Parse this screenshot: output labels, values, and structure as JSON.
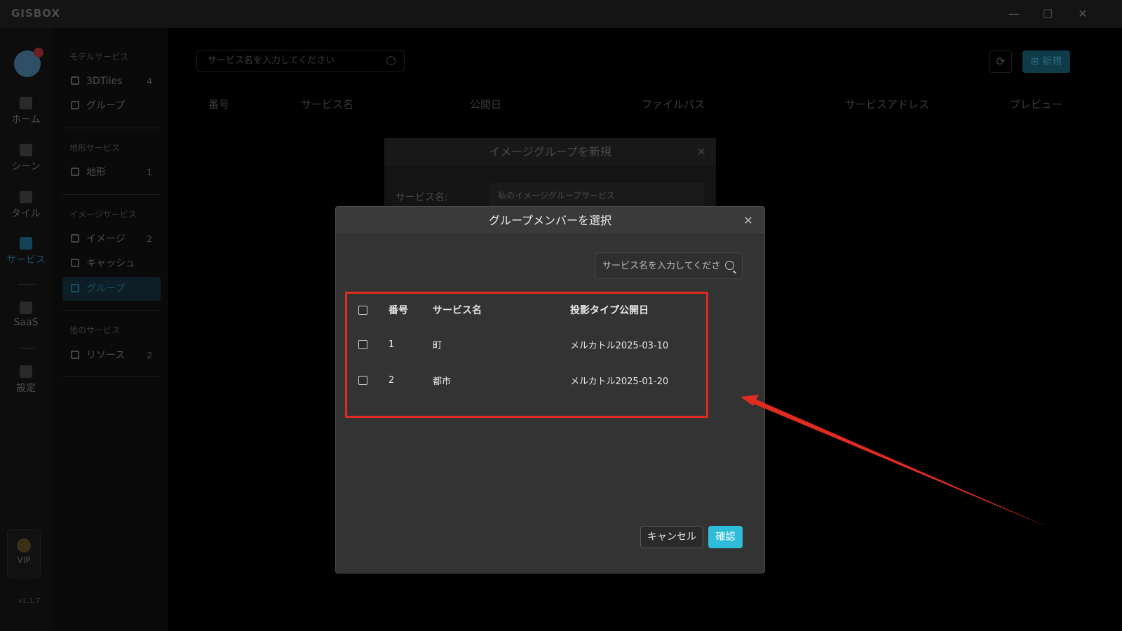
{
  "app": {
    "logo": "GISBOX",
    "window_controls": {
      "minimize": "—",
      "maximize": "☐",
      "close": "✕"
    },
    "version": "v1.1.7"
  },
  "rail": {
    "items": [
      {
        "label": "ホーム",
        "icon": "home-icon"
      },
      {
        "label": "シーン",
        "icon": "scene-icon"
      },
      {
        "label": "タイル",
        "icon": "tile-icon"
      },
      {
        "label": "サービス",
        "icon": "service-icon",
        "active": true
      },
      {
        "label": "SaaS",
        "icon": "saas-icon"
      },
      {
        "label": "設定",
        "icon": "settings-icon"
      }
    ],
    "vip": "VIP"
  },
  "sidebar": {
    "cat_model": "モデルサービス",
    "item_3dtiles": {
      "label": "3DTiles",
      "count": "4"
    },
    "item_model_group": {
      "label": "グループ"
    },
    "cat_terrain": "地形サービス",
    "item_terrain": {
      "label": "地形",
      "count": "1"
    },
    "cat_image": "イメージサービス",
    "item_image": {
      "label": "イメージ",
      "count": "2"
    },
    "item_cache": {
      "label": "キャッシュ"
    },
    "item_image_group": {
      "label": "グループ"
    },
    "cat_other": "他のサービス",
    "item_resource": {
      "label": "リソース",
      "count": "2"
    }
  },
  "main": {
    "search_placeholder": "サービス名を入力してください",
    "refresh": "⟳",
    "new_button": "新規",
    "columns": [
      "番号",
      "サービス名",
      "公開日",
      "ファイルパス",
      "サービスアドレス",
      "プレビュー"
    ]
  },
  "bg_modal": {
    "title": "イメージグループを新規",
    "close": "✕",
    "service_name_label": "サービス名:",
    "service_name_value": "私のイメージグループサービス"
  },
  "dialog": {
    "title": "グループメンバーを選択",
    "close": "✕",
    "search_placeholder": "サービス名を入力してください",
    "table": {
      "headers": [
        "番号",
        "サービス名",
        "投影タイプ公開日"
      ],
      "rows": [
        {
          "no": "1",
          "name": "町",
          "projection_date": "メルカトル2025-03-10"
        },
        {
          "no": "2",
          "name": "都市",
          "projection_date": "メルカトル2025-01-20"
        }
      ]
    },
    "cancel": "キャンセル",
    "confirm": "確認"
  },
  "annotation": {
    "color": "#e02b20"
  }
}
